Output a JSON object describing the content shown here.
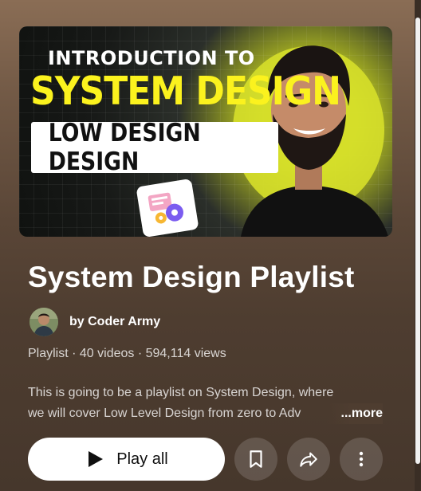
{
  "thumbnail": {
    "line1": "INTRODUCTION TO",
    "line2": "SYSTEM DESIGN",
    "box_text": "LOW DESIGN DESIGN",
    "badge_icon": "gear-diagram-icon",
    "accent": "#fbf21e"
  },
  "playlist": {
    "title": "System Design Playlist",
    "channel": "by Coder Army",
    "meta": "Playlist · 40 videos · 594,114 views",
    "description_line1": "This is going to be a playlist on System Design, where",
    "description_line2": "we will cover Low Level Design from zero to Adv",
    "more_label": "...more"
  },
  "actions": {
    "play_all_label": "Play all",
    "play_icon": "play-icon",
    "save_icon": "bookmark-icon",
    "share_icon": "share-icon",
    "more_icon": "more-vert-icon"
  }
}
